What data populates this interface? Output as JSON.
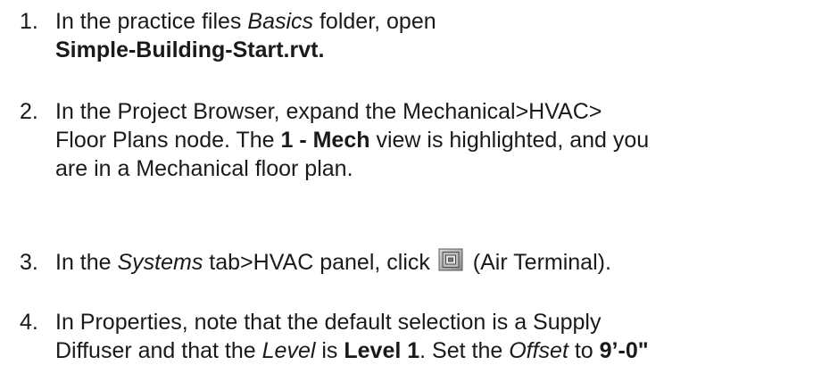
{
  "steps": [
    {
      "number": "1.",
      "lines": [
        {
          "a": "In the practice files ",
          "italic": "Basics",
          "b": " folder, open"
        },
        {
          "bold": "Simple-Building-Start.rvt."
        }
      ]
    },
    {
      "number": "2.",
      "line1": "In the Project Browser, expand the Mechanical>HVAC>",
      "line2_a": "Floor Plans node. The ",
      "line2_bold": "1 - Mech",
      "line2_b": " view is highlighted, and you",
      "line3": "are in a Mechanical floor plan."
    },
    {
      "number": "3.",
      "a": "In the ",
      "italic": "Systems",
      "b": " tab>HVAC panel, click",
      "icon": "air-terminal-icon",
      "c": " (Air Terminal)."
    },
    {
      "number": "4.",
      "line1": "In Properties, note that the default selection is a Supply",
      "line2_a": "Diffuser and that the ",
      "line2_italic1": "Level",
      "line2_b": " is ",
      "line2_bold1": "Level 1",
      "line2_c": ". Set the ",
      "line2_italic2": "Offset",
      "line2_d": " to ",
      "line2_bold2": "9’-0\""
    }
  ]
}
